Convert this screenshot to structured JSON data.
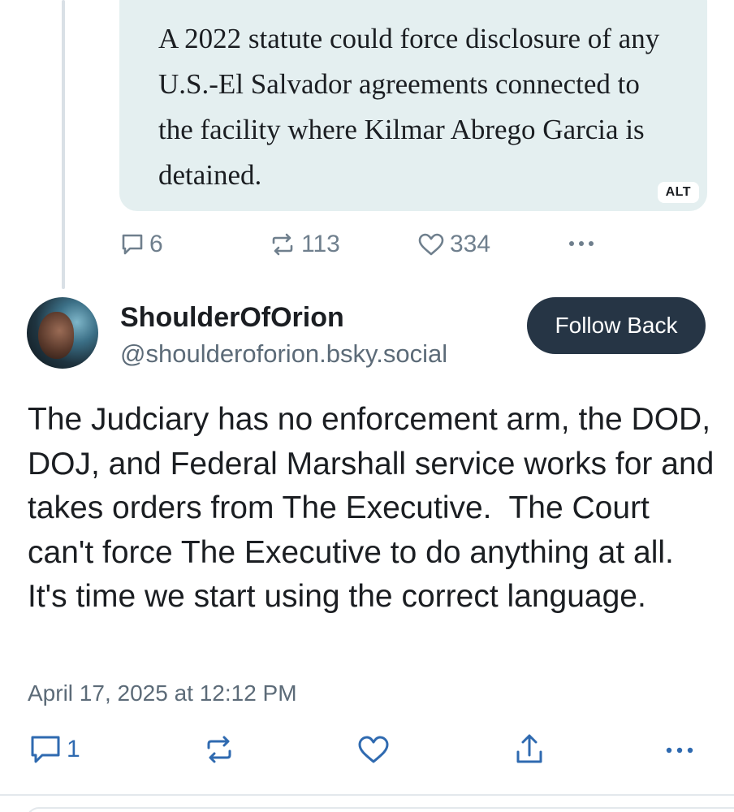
{
  "parent_post": {
    "image_text": "A 2022 statute could force disclosure of any U.S.-El Salvador agreements connected to the facility where Kilmar Abrego Garcia is detained.",
    "alt_badge": "ALT",
    "reply_count": "6",
    "repost_count": "113",
    "like_count": "334",
    "reply_icon": "speech-bubble-icon",
    "repost_icon": "repost-arrows-icon",
    "like_icon": "heart-icon",
    "more_icon": "more-dots-icon"
  },
  "post": {
    "author": {
      "display_name": "ShoulderOfOrion",
      "handle": "@shoulderoforion.bsky.social"
    },
    "follow_label": "Follow Back",
    "text": "The Judciary has no enforcement arm, the DOD, DOJ, and Federal Marshall service works for and takes orders from The Executive.  The Court can't force The Executive to do anything at all.  It's time we start using the correct language.",
    "timestamp": "April 17, 2025 at 12:12 PM",
    "reply_count": "1",
    "reply_icon": "speech-bubble-icon",
    "repost_icon": "repost-arrows-icon",
    "like_icon": "heart-icon",
    "share_icon": "share-icon",
    "more_icon": "more-dots-icon"
  },
  "colors": {
    "accent_button": "#263545",
    "card_background": "#e4eff0",
    "muted_text": "#5c6b78",
    "icon_color": "#6f7f8d"
  }
}
